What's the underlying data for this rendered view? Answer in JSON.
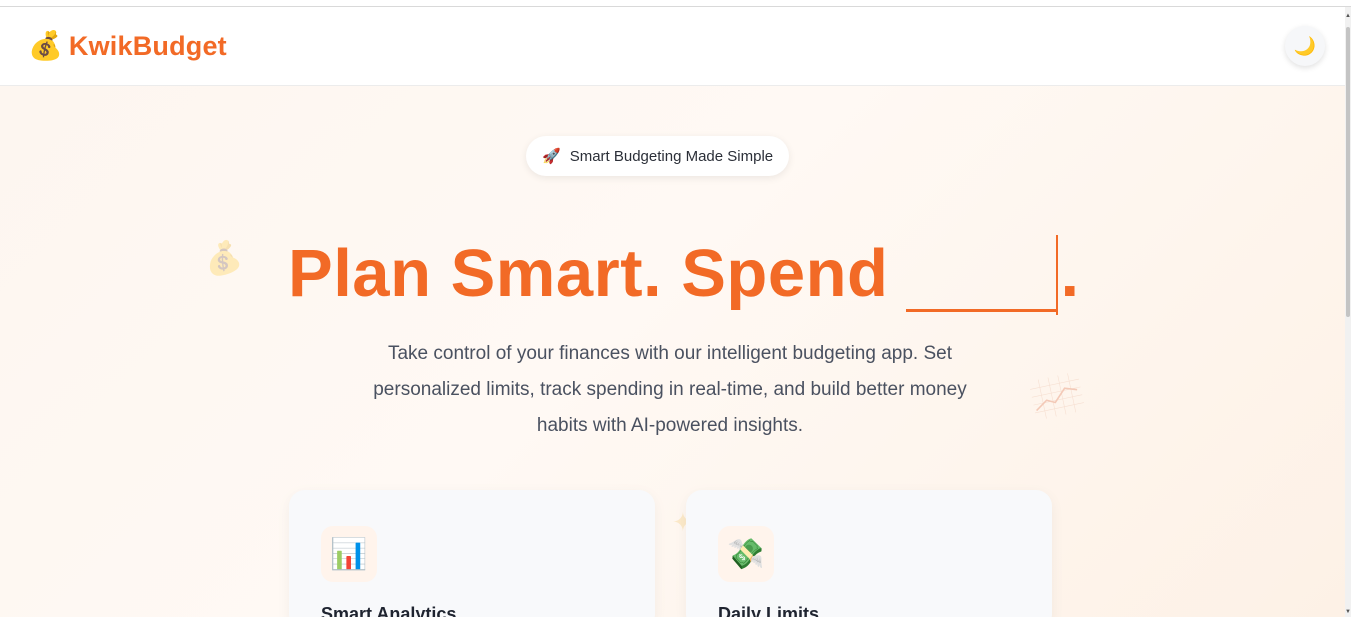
{
  "header": {
    "brand_icon": "💰",
    "brand_name": "KwikBudget",
    "theme_toggle_icon": "🌙",
    "theme_toggle_icon_name": "moon-icon"
  },
  "hero": {
    "badge_icon": "🚀",
    "badge_text": "Smart Budgeting Made Simple",
    "headline": "Plan Smart. Spend",
    "headline_period": ".",
    "subtitle": "Take control of your finances with our intelligent budgeting app. Set personalized limits, track spending in real-time, and build better money habits with AI-powered insights."
  },
  "features": [
    {
      "icon": "📊",
      "icon_name": "bar-chart-icon",
      "title": "Smart Analytics"
    },
    {
      "icon": "💸",
      "icon_name": "money-wings-icon",
      "title": "Daily Limits"
    }
  ],
  "colors": {
    "accent": "#f26a26",
    "text": "#2b2f38",
    "muted": "#4a5160",
    "card_bg": "#f8f9fb"
  }
}
